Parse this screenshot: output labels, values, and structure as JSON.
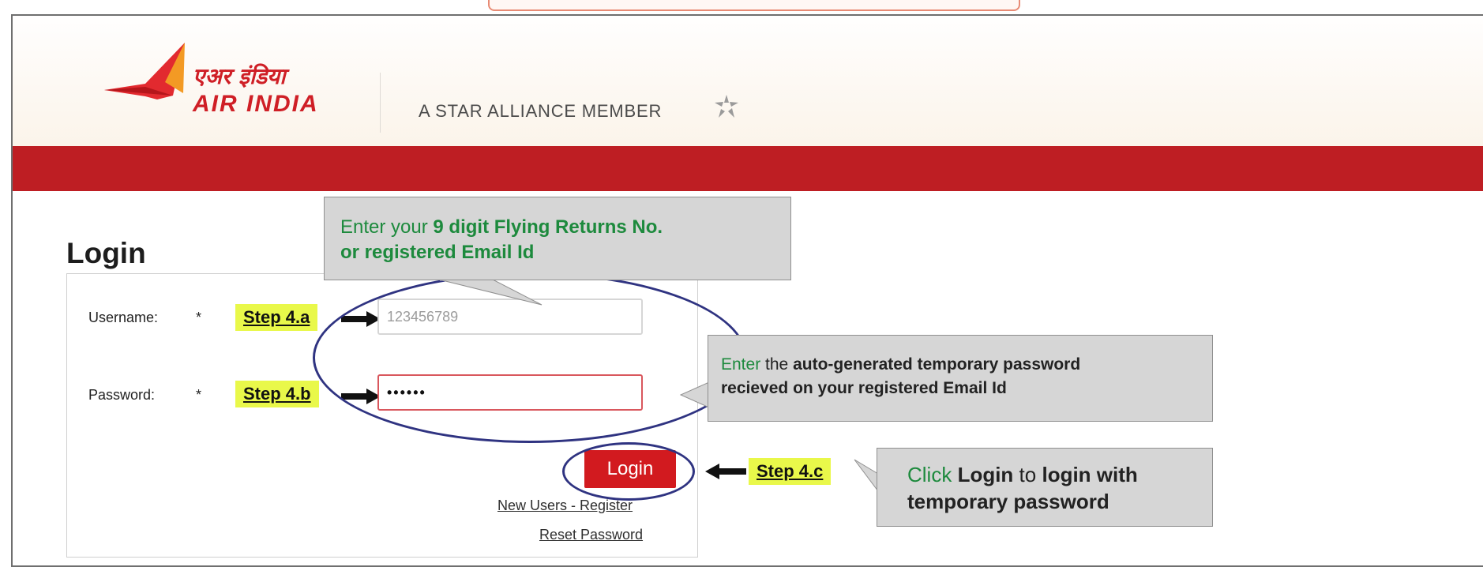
{
  "brand": {
    "logo_hindi": "एअर इंडिया",
    "logo_english": "AIR INDIA",
    "alliance_text": "A STAR ALLIANCE MEMBER"
  },
  "login": {
    "title": "Login",
    "username_label": "Username:",
    "username_required": "*",
    "username_value": "123456789",
    "password_label": "Password:",
    "password_required": "*",
    "password_value": "••••••",
    "login_button": "Login",
    "register_link": "New Users - Register",
    "reset_link": "Reset Password"
  },
  "steps": {
    "step_a": "Step 4.a",
    "step_b": "Step 4.b",
    "step_c": "Step 4.c"
  },
  "callouts": {
    "username": {
      "line1_normal": "Enter your ",
      "line1_bold": "9 digit Flying Returns No.",
      "line2_bold": "or registered Email Id"
    },
    "password": {
      "line1_green": "Enter",
      "line1_normal": " the ",
      "line1_bold": "auto-generated temporary password",
      "line2_bold": "recieved on your registered Email Id"
    },
    "login": {
      "line1_green": "Click ",
      "line1_bold_a": "Login",
      "line1_normal": " to ",
      "line1_bold_b": "login with",
      "line2_bold": "temporary password"
    }
  },
  "colors": {
    "brand_red": "#be1e23",
    "button_red": "#d21a1f",
    "highlight_yellow": "#e9f84a",
    "ellipse_blue": "#2f3381",
    "callout_grey": "#d6d6d6",
    "callout_green": "#1d8a3d"
  },
  "icons": {
    "logo_mark": "flying-swan-icon",
    "alliance": "star-alliance-icon",
    "arrow": "right-arrow-icon",
    "arrow_left": "left-arrow-icon"
  }
}
